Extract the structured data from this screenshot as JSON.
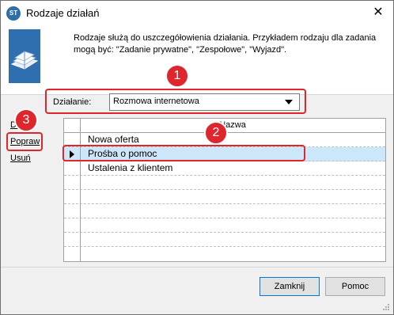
{
  "window": {
    "title": "Rodzaje działań",
    "close_symbol": "✕"
  },
  "description": "Rodzaje służą do uszczegółowienia działania. Przykładem rodzaju dla zadania mogą być: \"Zadanie prywatne\", \"Zespołowe\", \"Wyjazd\".",
  "dzialanie": {
    "label": "Działanie:",
    "selected": "Rozmowa internetowa"
  },
  "links": {
    "add": "Dodaj",
    "edit": "Popraw",
    "delete": "Usuń"
  },
  "grid": {
    "column_header": "Nazwa",
    "rows": [
      "Nowa oferta",
      "Prośba o pomoc",
      "Ustalenia z klientem"
    ],
    "selected_index": 1
  },
  "buttons": {
    "close": "Zamknij",
    "help": "Pomoc"
  },
  "annotations": [
    "1",
    "2",
    "3"
  ],
  "colors": {
    "annotation": "#e0262d",
    "selection": "#cce6fa"
  }
}
